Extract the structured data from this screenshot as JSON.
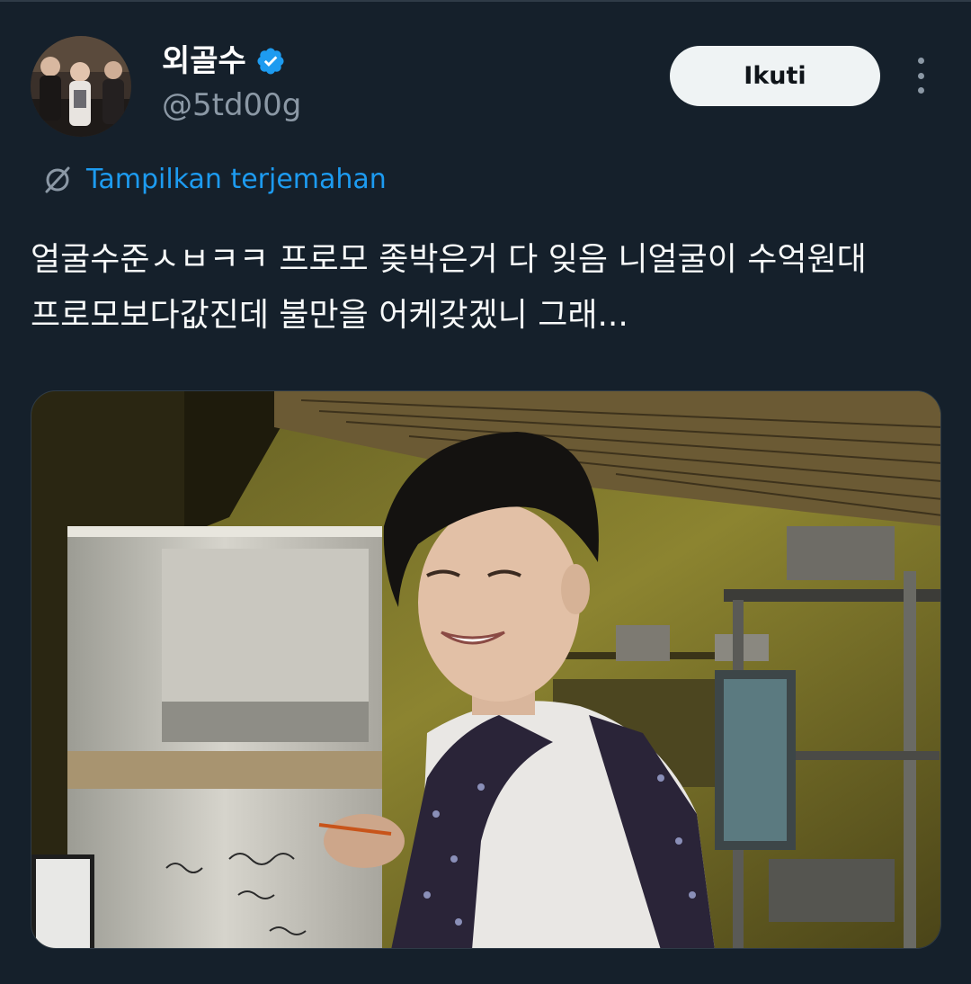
{
  "tweet": {
    "author": {
      "display_name": "외골수",
      "handle": "@5td00g",
      "verified": true,
      "verified_color": "#1d9bf0"
    },
    "follow_label": "Ikuti",
    "translate_label": "Tampilkan terjemahan",
    "text": "얼굴수준ㅅㅂㅋㅋ 프로모 좆박은거 다 잊음 니얼굴이 수억원대 프로모보다값진데 불만을 어케갖겠니 그래...",
    "media": {
      "type": "photo"
    }
  },
  "theme": {
    "background": "#15202b",
    "text": "#f7f9f9",
    "secondary": "#8b98a5",
    "accent": "#1d9bf0",
    "button_bg": "#eff3f4"
  },
  "icons": {
    "verified": "verified-badge-icon",
    "translate": "globe-translate-icon",
    "more": "more-options-icon"
  }
}
